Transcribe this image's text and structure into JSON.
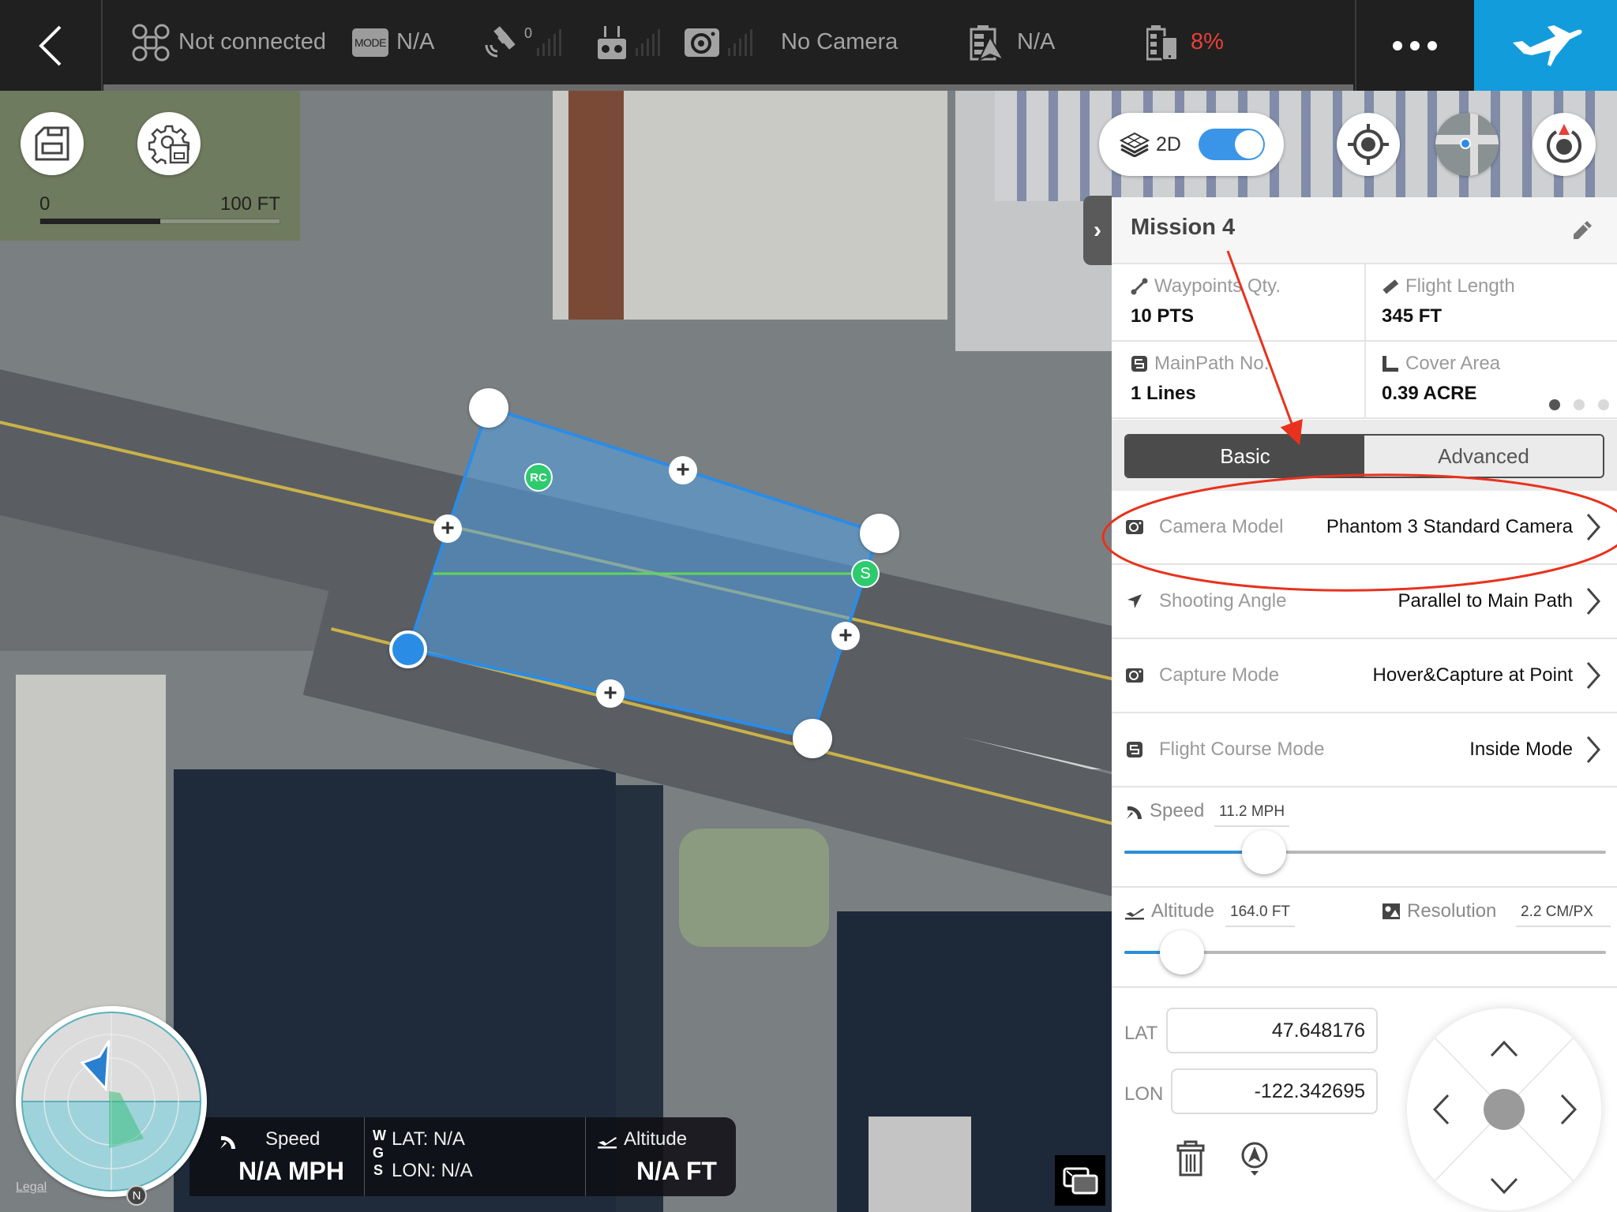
{
  "topbar": {
    "connection_status": "Not connected",
    "mode_badge": "MODE",
    "mode_value": "N/A",
    "gps_count": "0",
    "camera_status": "No Camera",
    "aircraft_battery": "N/A",
    "device_battery": "8%",
    "device_battery_color": "#e8403a",
    "accent_color": "#139cdc"
  },
  "map": {
    "scale_start": "0",
    "scale_end": "100 FT",
    "view_toggle_label": "2D",
    "view_toggle_on": true,
    "waypoint_rc_label": "RC",
    "waypoint_start_label": "S",
    "legal_link": "Legal",
    "compass_north": "N"
  },
  "telemetry": {
    "speed_label": "Speed",
    "speed_value": "N/A MPH",
    "wgs_letters": [
      "W",
      "G",
      "S"
    ],
    "lat": "LAT: N/A",
    "lon": "LON: N/A",
    "altitude_label": "Altitude",
    "altitude_value": "N/A FT"
  },
  "panel": {
    "title": "Mission 4",
    "stats": [
      {
        "label": "Waypoints Qty.",
        "value": "10 PTS",
        "icon": "waypoint-icon"
      },
      {
        "label": "Flight Length",
        "value": "345 FT",
        "icon": "ruler-icon"
      },
      {
        "label": "MainPath No.",
        "value": "1 Lines",
        "icon": "mainpath-icon"
      },
      {
        "label": "Cover Area",
        "value": "0.39 ACRE",
        "icon": "area-icon"
      }
    ],
    "page_dots": {
      "count": 3,
      "active": 0
    },
    "tabs": [
      {
        "label": "Basic",
        "active": true
      },
      {
        "label": "Advanced",
        "active": false
      }
    ],
    "settings": [
      {
        "label": "Camera Model",
        "value": "Phantom 3 Standard Camera",
        "icon": "camera-icon"
      },
      {
        "label": "Shooting Angle",
        "value": "Parallel to Main Path",
        "icon": "direction-arrow-icon"
      },
      {
        "label": "Capture Mode",
        "value": "Hover&Capture at Point",
        "icon": "camera-icon"
      },
      {
        "label": "Flight Course Mode",
        "value": "Inside Mode",
        "icon": "course-icon"
      }
    ],
    "speed": {
      "label": "Speed",
      "value": "11.2 MPH",
      "slider_fraction": 0.29
    },
    "altitude": {
      "label": "Altitude",
      "value": "164.0 FT",
      "slider_fraction": 0.12
    },
    "resolution": {
      "label": "Resolution",
      "value": "2.2 CM/PX"
    },
    "lat_label": "LAT",
    "lat_value": "47.648176",
    "lon_label": "LON",
    "lon_value": "-122.342695"
  },
  "annotation": {
    "color": "#e8321e"
  }
}
